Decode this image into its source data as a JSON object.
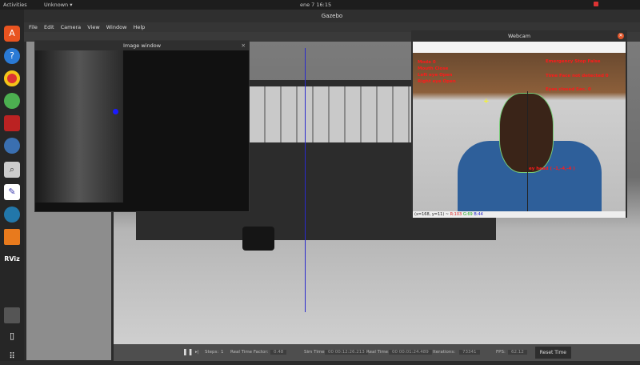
{
  "topbar": {
    "activities": "Activities",
    "app_menu": "Unknown ▾",
    "clock": "ene 7  16:15"
  },
  "gazebo": {
    "title": "Gazebo",
    "menu": [
      "File",
      "Edit",
      "Camera",
      "View",
      "Window",
      "Help"
    ]
  },
  "image_window": {
    "title": "Image window"
  },
  "webcam": {
    "title": "Webcam",
    "overlay_left": [
      "Mode 0",
      "Mouth Close",
      "Left eye Open",
      "Right eye Open"
    ],
    "overlay_right": [
      "Emergency Stop False",
      "Time Face not detected 0",
      "Eyes closed Sec. 0"
    ],
    "head_text": "ey head ( -1,-4,-4 )",
    "status_prefix": "(x=168, y=11) ~",
    "status_r": "R:103",
    "status_g": "G:69",
    "status_b": "B:44"
  },
  "bottombar": {
    "steps_label": "Steps:",
    "steps": "1",
    "rtf_label": "Real Time Factor:",
    "rtf": "0.48",
    "sim_label": "Sim Time:",
    "sim": "00 00:12:26.213",
    "real_label": "Real Time:",
    "real": "00 00:01:24.489",
    "iter_label": "Iterations:",
    "iter": "73341",
    "fps_label": "FPS:",
    "fps": "62.12",
    "reset": "Reset Time"
  }
}
